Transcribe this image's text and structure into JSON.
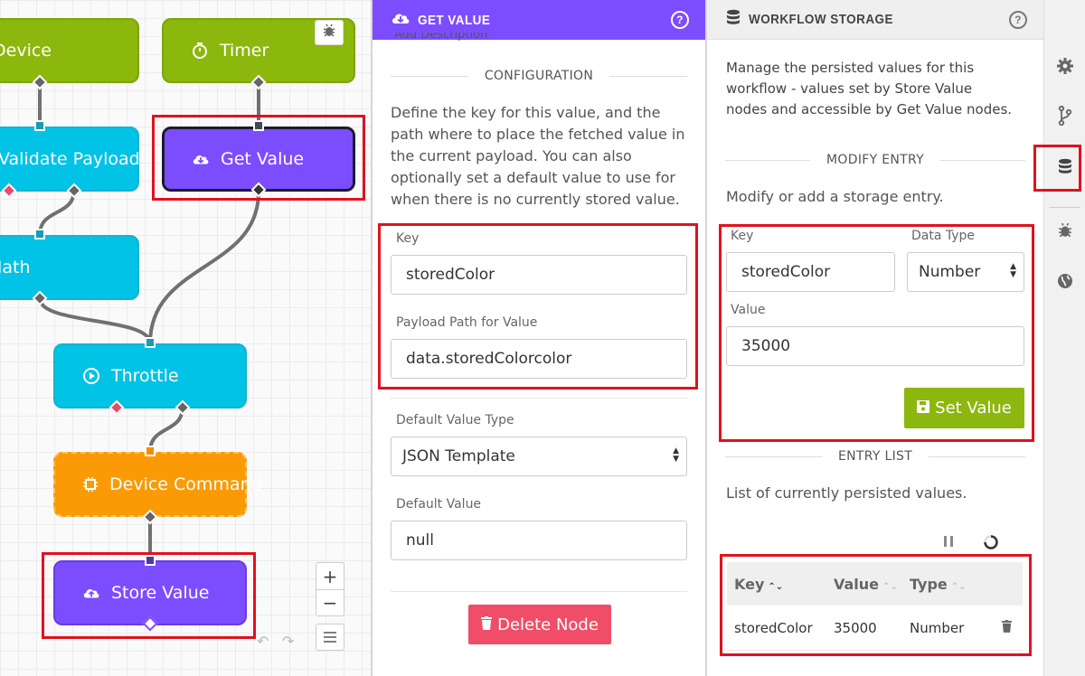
{
  "canvas": {
    "nodes": {
      "device": "Device",
      "timer": "Timer",
      "validate": "Validate Payload",
      "get_value": "Get Value",
      "math": "Math",
      "throttle": "Throttle",
      "device_command": "Device Command",
      "store_value": "Store Value"
    },
    "zoom_in": "+",
    "zoom_out": "−"
  },
  "get_value_panel": {
    "title": "Get Value",
    "cut_text": "Add Description",
    "section": "CONFIGURATION",
    "description": "Define the key for this value, and the path where to place the fetched value in the current payload. You can also optionally set a default value to use for when there is no currently stored value.",
    "key_label": "Key",
    "key_value": "storedColor",
    "path_label": "Payload Path for Value",
    "path_value": "data.storedColorcolor",
    "default_type_label": "Default Value Type",
    "default_type_value": "JSON Template",
    "default_value_label": "Default Value",
    "default_value": "null",
    "delete_button": "Delete Node"
  },
  "storage_panel": {
    "title": "Workflow Storage",
    "intro": "Manage the persisted values for this workflow - values set by Store Value nodes and accessible by Get Value nodes.",
    "modify_section": "MODIFY ENTRY",
    "modify_desc": "Modify or add a storage entry.",
    "key_label": "Key",
    "key_value": "storedColor",
    "type_label": "Data Type",
    "type_value": "Number",
    "value_label": "Value",
    "value_value": "35000",
    "set_button": "Set Value",
    "list_section": "ENTRY LIST",
    "list_desc": "List of currently persisted values.",
    "table": {
      "headers": [
        "Key",
        "Value",
        "Type"
      ],
      "rows": [
        {
          "key": "storedColor",
          "value": "35000",
          "type": "Number"
        }
      ]
    }
  },
  "rail": {
    "icons": [
      "gear-icon",
      "branch-icon",
      "database-icon",
      "bug-icon",
      "globe-icon"
    ]
  },
  "colors": {
    "accent_purple": "#7c4dff",
    "green": "#8cb70c",
    "cyan": "#00c3e6",
    "orange": "#fa9a05",
    "danger": "#f04e68",
    "highlight": "#e0121e"
  }
}
